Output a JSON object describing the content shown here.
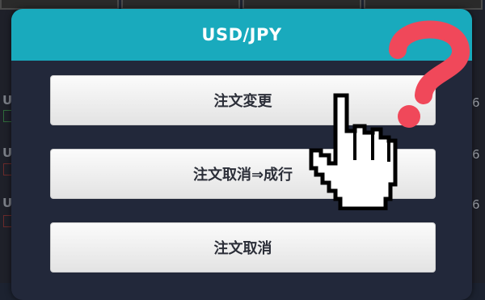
{
  "dialog": {
    "title": "USD/JPY",
    "buttons": [
      {
        "label": "注文変更"
      },
      {
        "label": "注文取消⇒成行"
      },
      {
        "label": "注文取消"
      }
    ]
  },
  "overlay": {
    "question_icon": "question-mark-icon",
    "pointer_icon": "hand-pointer-icon",
    "question_color": "#f0485a"
  },
  "colors": {
    "header": "#19aabd",
    "dialog_body": "#22283a",
    "button": "#f1f1f1"
  }
}
